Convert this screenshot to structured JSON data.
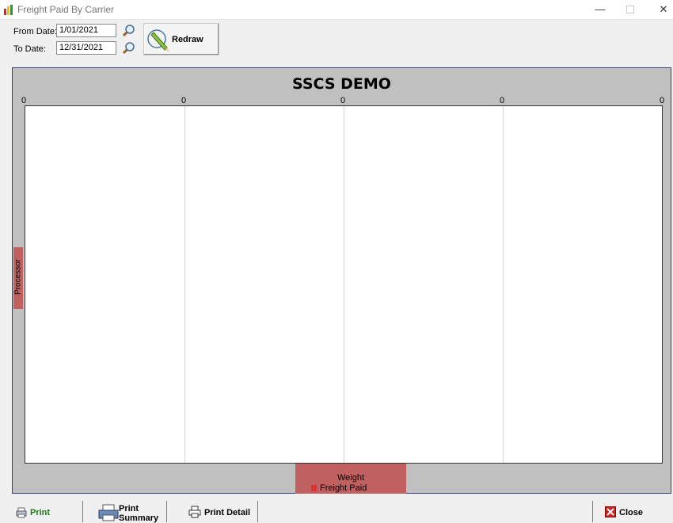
{
  "window": {
    "title": "Freight Paid By Carrier",
    "controls": {
      "minimize": "—",
      "close": "✕"
    }
  },
  "filters": {
    "from_label": "From Date:",
    "from_value": "1/01/2021",
    "to_label": "To Date:",
    "to_value": "12/31/2021"
  },
  "redraw_label": "Redraw",
  "chart": {
    "title": "SSCS DEMO",
    "x_ticks": [
      "0",
      "0",
      "0",
      "0",
      "0"
    ],
    "y_axis_label": "Processor",
    "x_axis_label": "Weight",
    "legend": [
      "Freight Paid"
    ]
  },
  "chart_data": {
    "type": "bar",
    "title": "SSCS DEMO",
    "xlabel": "Weight",
    "ylabel": "Processor",
    "x_ticks": [
      "0",
      "0",
      "0",
      "0",
      "0"
    ],
    "categories": [],
    "series": [
      {
        "name": "Freight Paid",
        "values": [],
        "color": "#e23030"
      }
    ],
    "grid": true,
    "legend_placement": "bottom"
  },
  "toolbar": {
    "print": "Print",
    "print_summary_line1": "Print",
    "print_summary_line2": "Summary",
    "print_detail": "Print Detail",
    "close": "Close"
  },
  "colors": {
    "axis_tag": "#c06060",
    "chart_background": "#c0c0c0",
    "print_text": "#1a7a1a"
  }
}
